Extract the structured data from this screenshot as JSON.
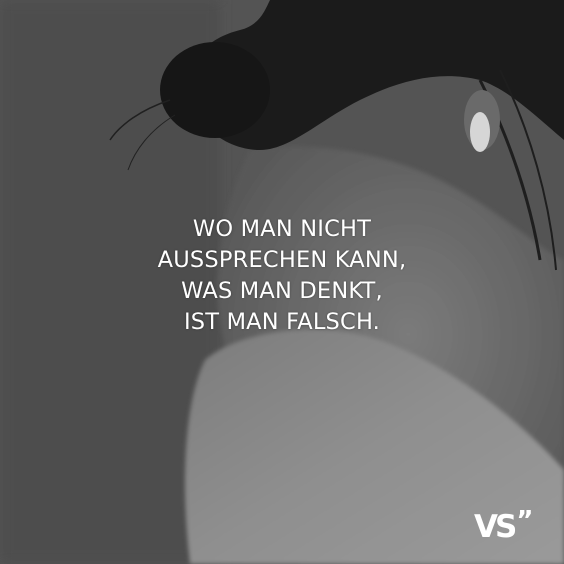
{
  "quote": {
    "lines": [
      "WO MAN NICHT",
      "AUSSPRECHEN KANN,",
      "WAS MAN DENKT,",
      "IST MAN FALSCH."
    ]
  },
  "logo": {
    "letters": "VS",
    "mark": "”"
  }
}
